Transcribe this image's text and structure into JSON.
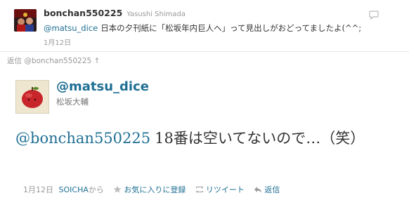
{
  "parent_tweet": {
    "screen_name": "bonchan550225",
    "full_name": "Yasushi Shimada",
    "mention": "@matsu_dice",
    "text": "日本の夕刊紙に「松坂年内巨人へ」って見出しがおどってましたよ(^^;",
    "date": "1月12日"
  },
  "reply_to": {
    "label": "返信 @bonchan550225 ↑"
  },
  "tweet": {
    "screen_name": "@matsu_dice",
    "full_name": "松坂大輔",
    "mention": "@bonchan550225",
    "text": "18番は空いてないので…（笑）",
    "date": "1月12日",
    "source_name": "SOICHA",
    "source_suffix": "から"
  },
  "actions": {
    "favorite": "お気に入りに登録",
    "retweet": "リツイート",
    "reply": "返信"
  },
  "colors": {
    "link": "#1f6f93",
    "muted": "#999999",
    "text": "#333333"
  }
}
